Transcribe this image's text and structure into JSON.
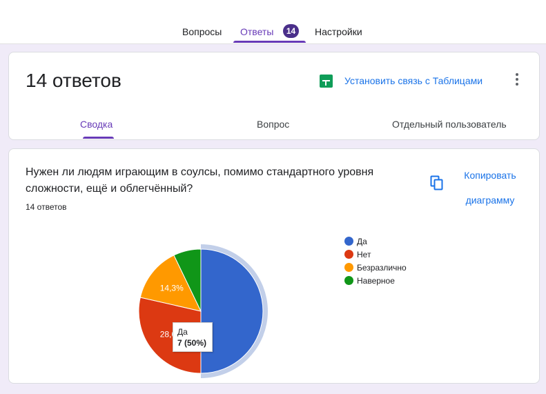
{
  "tabs": {
    "questions": "Вопросы",
    "answers": "Ответы",
    "answers_badge": "14",
    "settings": "Настройки"
  },
  "summary": {
    "title": "14 ответов",
    "sheets_link": "Установить связь с Таблицами",
    "sheets_icon": "sheets-icon",
    "more_icon": "more-vert-icon",
    "subtabs": [
      "Сводка",
      "Вопрос",
      "Отдельный пользователь"
    ]
  },
  "question": {
    "title": "Нужен ли людям играющим в соулсы,  помимо стандартного уровня сложности, ещё и облегчённый?",
    "count": "14 ответов",
    "copy_line1": "Копировать",
    "copy_line2": "диаграмму",
    "copy_icon": "copy-icon"
  },
  "chart_data": {
    "type": "pie",
    "categories": [
      "Да",
      "Нет",
      "Безразлично",
      "Наверное"
    ],
    "values": [
      7,
      4,
      2,
      1
    ],
    "colors": [
      "#3366cc",
      "#dc3912",
      "#ff9900",
      "#109618"
    ],
    "slice_labels": [
      "",
      "28,6%",
      "14,3%",
      ""
    ],
    "legend_position": "right",
    "highlighted": "Да",
    "tooltip": {
      "label": "Да",
      "value": "7 (50%)"
    }
  }
}
